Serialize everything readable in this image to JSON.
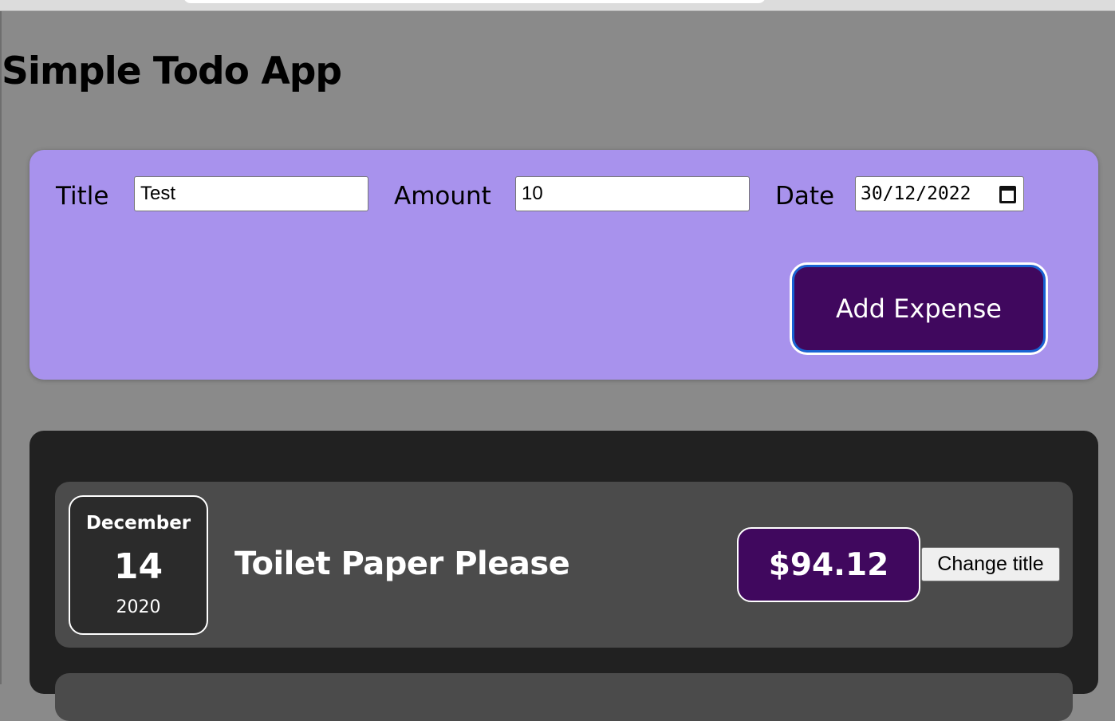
{
  "app": {
    "title": "Simple Todo App"
  },
  "form": {
    "title_label": "Title",
    "title_value": "Test",
    "amount_label": "Amount",
    "amount_value": "10",
    "date_label": "Date",
    "date_value": "30/12/2022",
    "submit_label": "Add Expense"
  },
  "expenses": [
    {
      "month": "December",
      "day": "14",
      "year": "2020",
      "title": "Toilet Paper Please",
      "amount": "$94.12",
      "change_label": "Change title"
    }
  ],
  "colors": {
    "page_bg": "#8a8a8a",
    "form_bg": "#a892ed",
    "accent": "#40085e",
    "list_bg": "#212121",
    "item_bg": "#4b4b4b"
  }
}
